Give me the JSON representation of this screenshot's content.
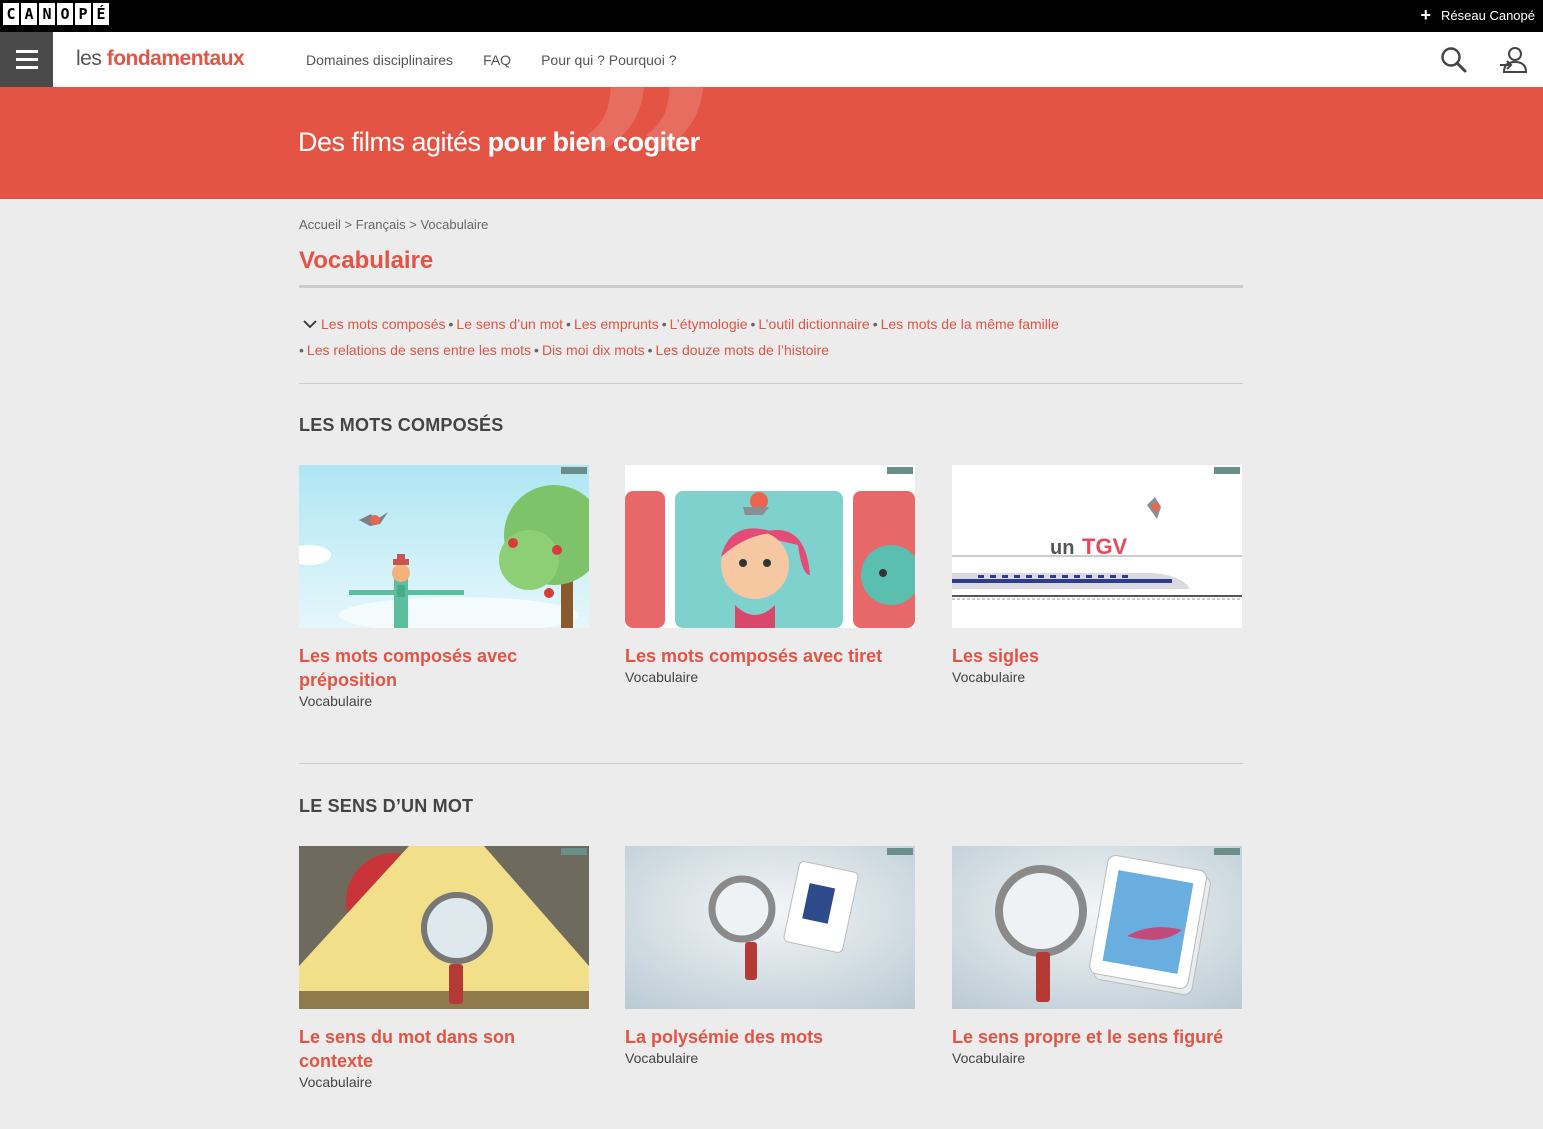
{
  "topbar": {
    "logo_letters": [
      "C",
      "A",
      "N",
      "O",
      "P",
      "É"
    ],
    "reseau_plus": "+",
    "reseau_label": "Réseau Canopé"
  },
  "nav": {
    "brand_les": "les",
    "brand_fond": "fondamentaux",
    "menu": [
      "Domaines disciplinaires",
      "FAQ",
      "Pour qui ? Pourquoi ?"
    ],
    "icons": [
      "menu-icon",
      "search-icon",
      "user-login-icon"
    ]
  },
  "banner": {
    "text_light": "Des films agités ",
    "text_bold": "pour bien cogiter",
    "quote_mark": "”"
  },
  "breadcrumb": {
    "items": [
      "Accueil",
      "Français",
      "Vocabulaire"
    ],
    "separator": " > "
  },
  "page_title": "Vocabulaire",
  "subnav": {
    "bullet": "•",
    "items": [
      "Les mots composés",
      "Le sens d’un mot",
      "Les emprunts",
      "L’étymologie",
      "L’outil dictionnaire",
      "Les mots de la même famille",
      "Les relations de sens entre les mots",
      "Dis moi dix mots",
      "Les douze mots de l’histoire"
    ]
  },
  "sections": [
    {
      "title": "LES MOTS COMPOSÉS",
      "cards": [
        {
          "title": "Les mots composés avec préposition",
          "subtitle": "Vocabulaire"
        },
        {
          "title": "Les mots composés avec tiret",
          "subtitle": "Vocabulaire"
        },
        {
          "title": "Les sigles",
          "subtitle": "Vocabulaire",
          "thumb_text_un": "un",
          "thumb_text_tgv": "TGV"
        }
      ]
    },
    {
      "title": "LE SENS D’UN MOT",
      "cards": [
        {
          "title": "Le sens du mot dans son contexte",
          "subtitle": "Vocabulaire"
        },
        {
          "title": "La polysémie des mots",
          "subtitle": "Vocabulaire"
        },
        {
          "title": "Le sens propre et le sens figuré",
          "subtitle": "Vocabulaire"
        }
      ]
    }
  ],
  "colors": {
    "accent": "#e35445",
    "background": "#ececec",
    "topbar": "#000000",
    "burger": "#4a4a4a"
  }
}
